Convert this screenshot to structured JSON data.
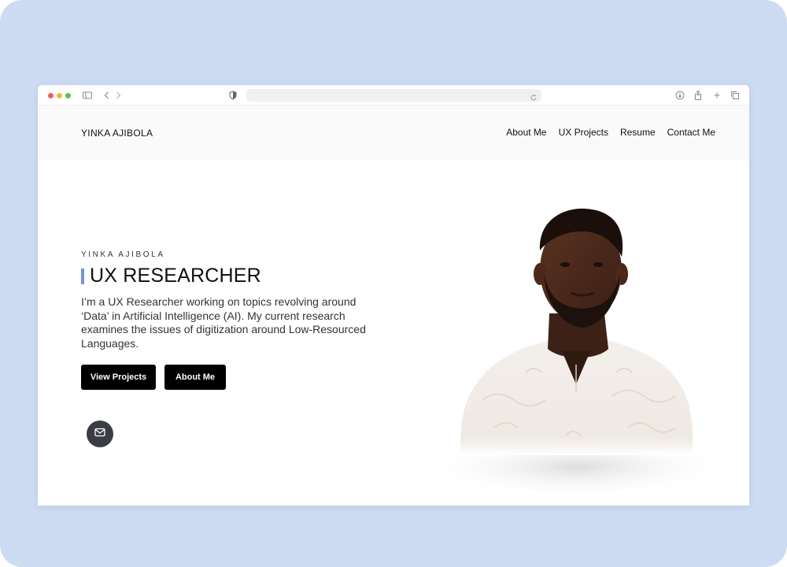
{
  "browser": {
    "icons": [
      "sidebar-icon",
      "back-icon",
      "forward-icon",
      "shield-icon",
      "reload-icon",
      "download-icon",
      "share-icon",
      "new-tab-icon",
      "tabs-icon"
    ],
    "url": ""
  },
  "header": {
    "logo": "YINKA AJIBOLA",
    "nav": [
      "About Me",
      "UX Projects",
      "Resume",
      "Contact Me"
    ]
  },
  "hero": {
    "eyebrow": "YINKA AJIBOLA",
    "title": "UX RESEARCHER",
    "description": "I’m a UX Researcher working on topics revolving around ‘Data’ in Artificial Intelligence (AI). My current research examines the issues of digitization around Low-Resourced Languages.",
    "buttons": {
      "view_projects": "View Projects",
      "about_me": "About Me"
    },
    "contact_icon": "mail-icon"
  },
  "colors": {
    "background": "#cddcf3",
    "accent_bar": "#6f96d8",
    "button": "#000000",
    "mail_button": "#3b3d45"
  }
}
